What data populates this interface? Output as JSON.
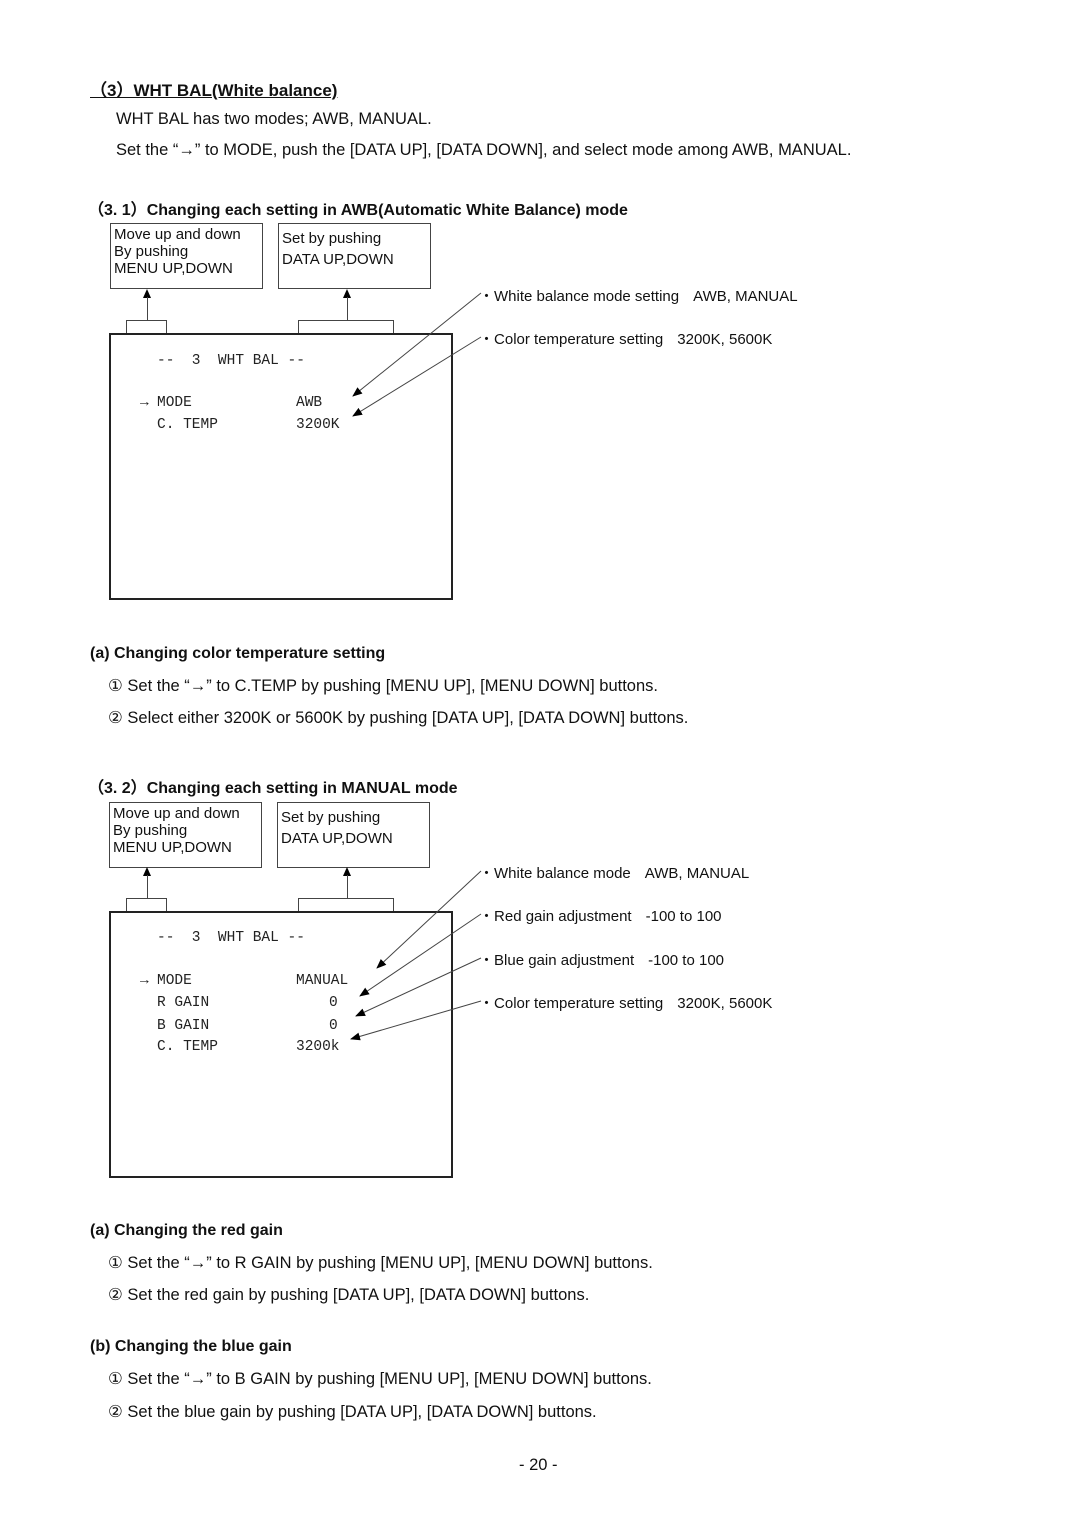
{
  "section_title": "（3）WHT BAL(White balance)",
  "intro": [
    "WHT BAL has two modes; AWB, MANUAL.",
    "Set the “→” to MODE, push the [DATA UP], [DATA DOWN], and select mode among AWB, MANUAL."
  ],
  "awb": {
    "heading": "（3. 1）Changing each setting in AWB(Automatic White Balance) mode",
    "menu_box": [
      "Move up and down",
      "By pushing",
      "MENU UP,DOWN"
    ],
    "data_box": [
      "Set by pushing",
      "DATA UP,DOWN"
    ],
    "screen": {
      "title": "--  3  WHT BAL --",
      "cursor": "→",
      "rows": [
        {
          "label": "MODE",
          "value": "AWB"
        },
        {
          "label": "C. TEMP",
          "value": "3200K"
        }
      ]
    },
    "callouts": [
      {
        "label": "White balance mode setting",
        "value": "AWB, MANUAL"
      },
      {
        "label": "Color temperature setting",
        "value": "3200K, 5600K"
      }
    ],
    "sub_a": {
      "heading": "(a) Changing color temperature setting",
      "steps": [
        {
          "num": "①",
          "text": "Set the “→” to C.TEMP by pushing [MENU UP], [MENU DOWN] buttons."
        },
        {
          "num": "②",
          "text": "Select either 3200K or 5600K by pushing [DATA UP], [DATA DOWN] buttons."
        }
      ]
    }
  },
  "manual": {
    "heading": "（3. 2）Changing each setting in MANUAL mode",
    "menu_box": [
      "Move up and down",
      "By pushing",
      "MENU UP,DOWN"
    ],
    "data_box": [
      "Set by pushing",
      "DATA UP,DOWN"
    ],
    "screen": {
      "title": "--  3  WHT BAL --",
      "cursor": "→",
      "rows": [
        {
          "label": "MODE",
          "value": "MANUAL"
        },
        {
          "label": "R GAIN",
          "value": "0"
        },
        {
          "label": "B GAIN",
          "value": "0"
        },
        {
          "label": "C. TEMP",
          "value": "3200k"
        }
      ]
    },
    "callouts": [
      {
        "label": "White balance mode",
        "value": "AWB, MANUAL"
      },
      {
        "label": "Red gain adjustment",
        "value": "-100 to 100"
      },
      {
        "label": "Blue gain adjustment",
        "value": "-100 to 100"
      },
      {
        "label": "Color temperature setting",
        "value": "3200K, 5600K"
      }
    ],
    "sub_a": {
      "heading": "(a) Changing the red gain",
      "steps": [
        {
          "num": "①",
          "text": "Set the “→” to R GAIN by pushing [MENU UP], [MENU DOWN] buttons."
        },
        {
          "num": "②",
          "text": "Set the red gain by pushing [DATA UP], [DATA DOWN] buttons."
        }
      ]
    },
    "sub_b": {
      "heading": "(b) Changing the blue gain",
      "steps": [
        {
          "num": "①",
          "text": "Set the “→” to B GAIN by pushing [MENU UP], [MENU DOWN] buttons."
        },
        {
          "num": "②",
          "text": "Set the blue gain by pushing [DATA UP], [DATA DOWN] buttons."
        }
      ]
    }
  },
  "bullet_glyph": "・",
  "page_number": "- 20 -"
}
